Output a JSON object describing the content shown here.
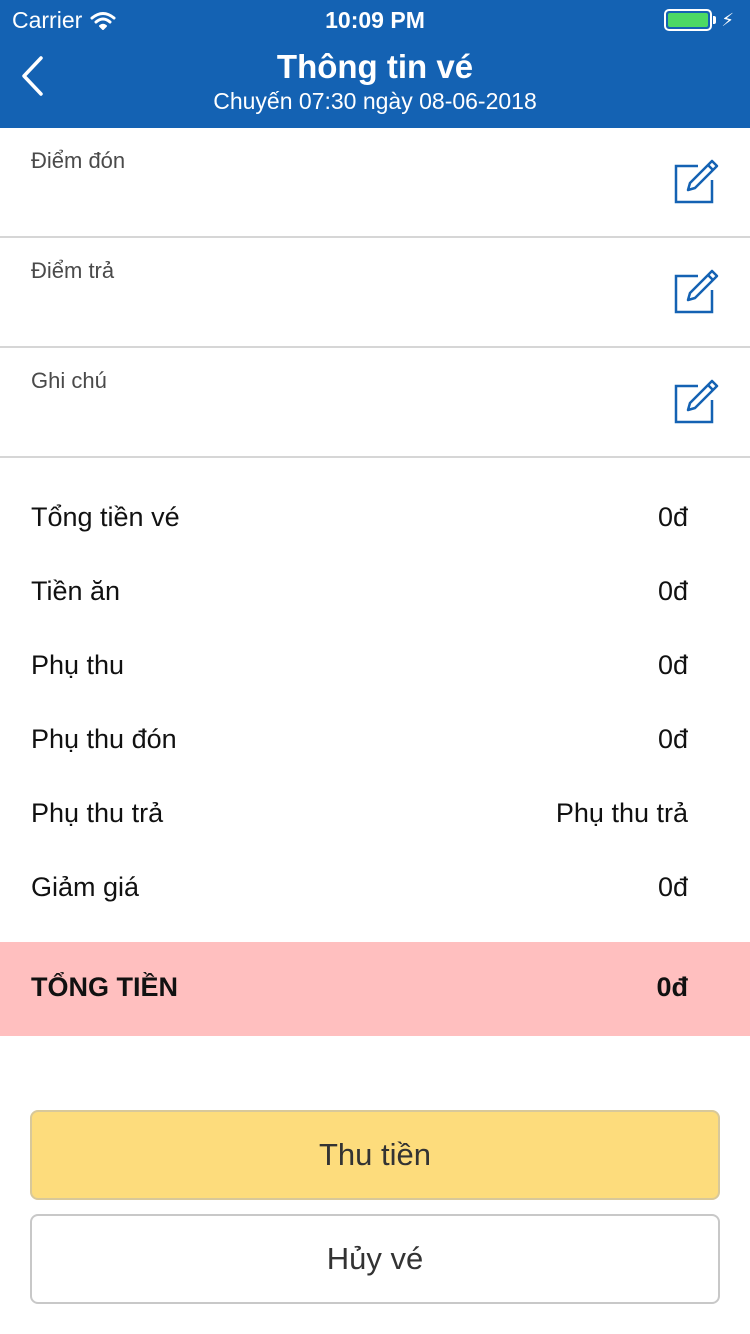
{
  "status_bar": {
    "carrier": "Carrier",
    "time": "10:09 PM",
    "battery_color": "#4cd964"
  },
  "nav": {
    "title": "Thông tin vé",
    "subtitle": "Chuyến 07:30 ngày 08-06-2018",
    "back_icon": "chevron-left-icon",
    "background": "#1462b3"
  },
  "fields": [
    {
      "label": "Điểm đón",
      "icon": "edit-icon"
    },
    {
      "label": "Điểm trả",
      "icon": "edit-icon"
    },
    {
      "label": "Ghi chú",
      "icon": "edit-icon"
    }
  ],
  "prices": [
    {
      "label": "Tổng tiền vé",
      "value": "0đ"
    },
    {
      "label": "Tiền ăn",
      "value": "0đ"
    },
    {
      "label": "Phụ thu",
      "value": "0đ"
    },
    {
      "label": "Phụ thu đón",
      "value": "0đ"
    },
    {
      "label": "Phụ thu trả",
      "value": "Phụ thu trả"
    },
    {
      "label": "Giảm giá",
      "value": "0đ"
    }
  ],
  "total": {
    "label": "TỔNG TIỀN",
    "value": "0đ",
    "background": "#ffbfbf"
  },
  "actions": {
    "collect_label": "Thu tiền",
    "collect_color": "#fddc7c",
    "cancel_label": "Hủy vé"
  }
}
